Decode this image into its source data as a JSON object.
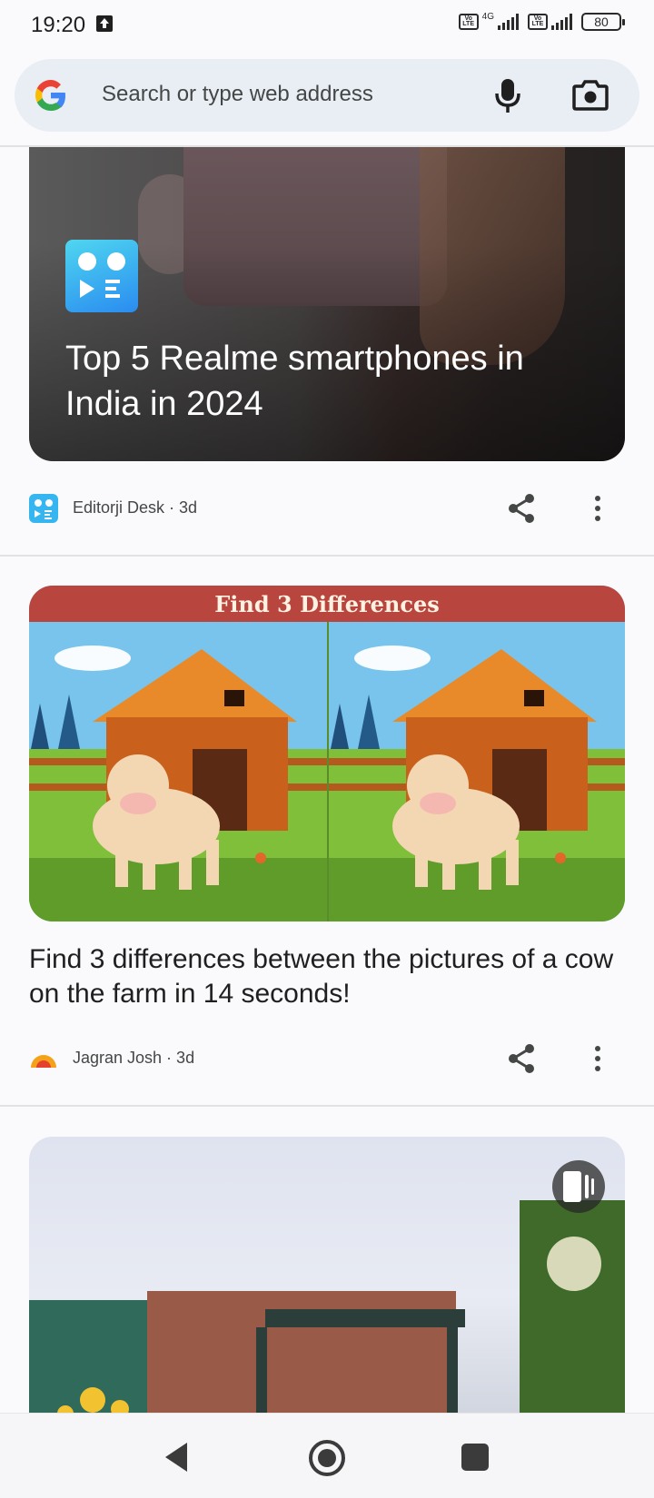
{
  "status_bar": {
    "time": "19:20",
    "network_type": "4G",
    "volte_label_1": "Vo LTE",
    "volte_label_2": "Vo LTE",
    "battery": "80"
  },
  "omnibox": {
    "placeholder": "Search or type web address",
    "icons": [
      "google-g-icon",
      "mic-icon",
      "camera-icon"
    ]
  },
  "feed": {
    "cards": [
      {
        "title": "Top 5 Realme smartphones in India in 2024",
        "source": "Editorji Desk",
        "age": "3d",
        "meta": "Editorji Desk · 3d"
      },
      {
        "image_banner": "Find 3 Differences",
        "title": "Find 3 differences between the pictures of a cow on the farm in 14 seconds!",
        "source": "Jagran Josh",
        "age": "3d",
        "meta": "Jagran Josh · 3d"
      },
      {
        "has_video_badge": true
      }
    ]
  },
  "nav": {
    "buttons": [
      "back",
      "home",
      "recents"
    ]
  },
  "colors": {
    "accent": "#1a73e8",
    "banner": "#b8463f",
    "background": "#fafafd"
  }
}
